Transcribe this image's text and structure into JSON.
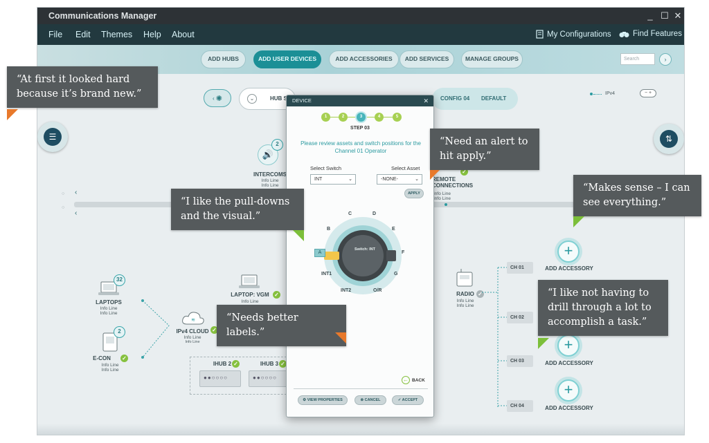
{
  "app": {
    "title": "Communications Manager"
  },
  "window_controls": [
    "_",
    "☐",
    "✕"
  ],
  "menu": {
    "items": [
      "File",
      "Edit",
      "Themes",
      "Help",
      "About"
    ],
    "my_configurations": "My Configurations",
    "find_features": "Find Features"
  },
  "toolbar": {
    "buttons": [
      "ADD HUBS",
      "ADD USER DEVICES",
      "ADD ACCESSORIES",
      "ADD SERVICES",
      "MANAGE GROUPS"
    ],
    "active_index": 1,
    "search_placeholder": "Search"
  },
  "config_bar": {
    "hub_label": "HUB S",
    "config": "CONFIG 04",
    "default": "DEFAULT",
    "ipv4": "IPv4"
  },
  "canvas": {
    "intercoms": {
      "label": "INTERCOMS",
      "info": [
        "Info Line",
        "Info Line"
      ],
      "badge": "2"
    },
    "remote": {
      "label": "REMOTE\nCONNECTIONS",
      "info": [
        "Info Line",
        "Info Line"
      ]
    },
    "laptops": {
      "label": "LAPTOPS",
      "info": [
        "Info Line",
        "Info Line"
      ],
      "badge": "32"
    },
    "laptop_vgm": {
      "label": "LAPTOP: VGM",
      "info": [
        "Info Line"
      ]
    },
    "ipv4_cloud": {
      "label": "IPv4 CLOUD",
      "info": [
        "Info Line",
        "Info Line"
      ]
    },
    "econ": {
      "label": "E-CON",
      "info": [
        "Info Line",
        "Info Line"
      ],
      "badge": "2"
    },
    "ihub2": {
      "label": "IHUB 2"
    },
    "ihub3": {
      "label": "IHUB 3"
    },
    "radio": {
      "label": "RADIO",
      "info": [
        "Info Line",
        "Info Line"
      ]
    },
    "channels": [
      "CH 01",
      "CH 02",
      "CH 03",
      "CH 04"
    ],
    "add_accessory": "ADD ACCESSORY"
  },
  "dialog": {
    "title": "DEVICE",
    "steps": [
      "1",
      "2",
      "3",
      "4",
      "5"
    ],
    "current_step_index": 2,
    "step_label": "STEP 03",
    "instruction": "Please review assets and switch positions for the Channel 01 Operator",
    "select_switch_label": "Select Switch",
    "select_switch_value": "INT",
    "select_asset_label": "Select Asset",
    "select_asset_value": "-NONE-",
    "apply": "APPLY",
    "dial_center": "Switch: INT",
    "dial_positions": [
      "A",
      "B",
      "C",
      "D",
      "E",
      "F",
      "G",
      "O/R",
      "INT2",
      "INT1"
    ],
    "back": "BACK",
    "view_properties": "VIEW PROPERTIES",
    "cancel": "CANCEL",
    "accept": "ACCEPT"
  },
  "callouts": {
    "c1": "“At first it looked hard because it’s brand new.”",
    "c2": "“Need an alert to hit apply.”",
    "c3": "“Makes sense – I can see everything.”",
    "c4": "“I like the pull-downs and the visual.”",
    "c5": "“I like not having to drill through a lot to accomplish a task.”",
    "c6": "“Needs better labels.”"
  },
  "colors": {
    "menubar": "#22393f",
    "accent_teal": "#1b8f96",
    "check_green": "#86c13f",
    "callout_bg": "#555a5c",
    "callout_tail": "#e8792b"
  }
}
